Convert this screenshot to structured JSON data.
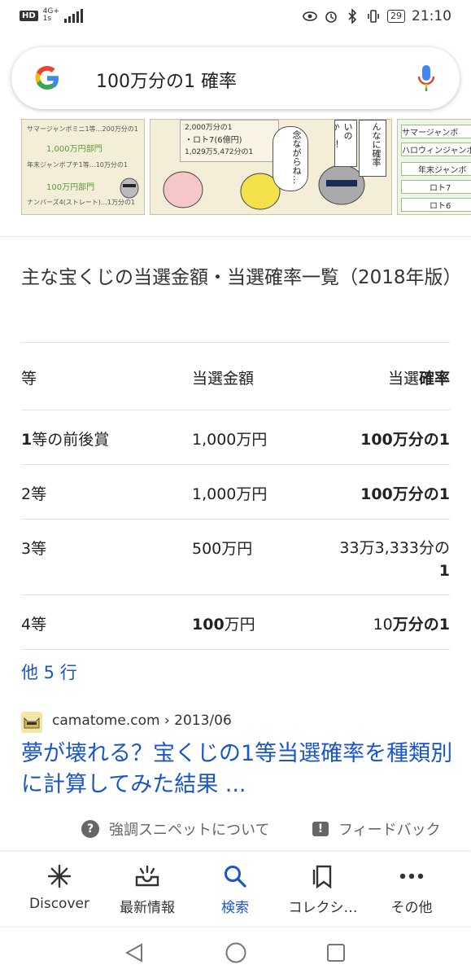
{
  "status_bar": {
    "hd": "HD",
    "network": "4G+",
    "network_sub": "1s",
    "battery": "29",
    "time": "21:10"
  },
  "search": {
    "query": "100万分の1 確率"
  },
  "snippet": {
    "title": "主な宝くじの当選金額・当選確率一覧（2018年版）",
    "table": {
      "headers": [
        "等",
        "当選金額",
        "当選確率"
      ],
      "rows": [
        [
          "1等の前後賞",
          "1,000万円",
          "100万分の1"
        ],
        [
          "2等",
          "1,000万円",
          "100万分の1"
        ],
        [
          "3等",
          "500万円",
          "33万3,333分の1"
        ],
        [
          "4等",
          "100万円",
          "10万分の1"
        ]
      ]
    },
    "more_rows": "他 5 行"
  },
  "image_strip_text": {
    "tile1": [
      "サマージャンボミニ1等…200万分の1",
      "1,000万円部門",
      "年末ジャンボプチ1等…10万分の1",
      "100万円部門",
      "ナンバーズ4(ストレート)…1万分の1"
    ],
    "tile2": [
      "2,000万分の1",
      "・ロト7(6億円)",
      "1,029万5,472分の1",
      "念ながらね…",
      "んなに確率",
      "いのか…！"
    ],
    "tile3": [
      "サマージャンボ",
      "ハロウィンジャンボ",
      "年末ジャンボ",
      "ロト7",
      "ロト6"
    ]
  },
  "result": {
    "source": "camatome.com › 2013/06",
    "title": "夢が壊れる？宝くじの1等当選確率を種類別に計算してみた結果 ...",
    "about_label": "強調スニペットについて",
    "feedback_label": "フィードバック"
  },
  "bottom_nav": {
    "items": [
      {
        "label": "Discover",
        "icon": "asterisk-icon"
      },
      {
        "label": "最新情報",
        "icon": "updates-tray-icon"
      },
      {
        "label": "検索",
        "icon": "search-icon"
      },
      {
        "label": "コレクシ…",
        "icon": "collections-icon"
      },
      {
        "label": "その他",
        "icon": "more-dots-icon"
      }
    ],
    "active_index": 2
  },
  "colors": {
    "link": "#1a56c8",
    "accent_blue": "#4285f4",
    "google_red": "#ea4335",
    "google_yellow": "#fbbc05",
    "google_green": "#34a853"
  }
}
